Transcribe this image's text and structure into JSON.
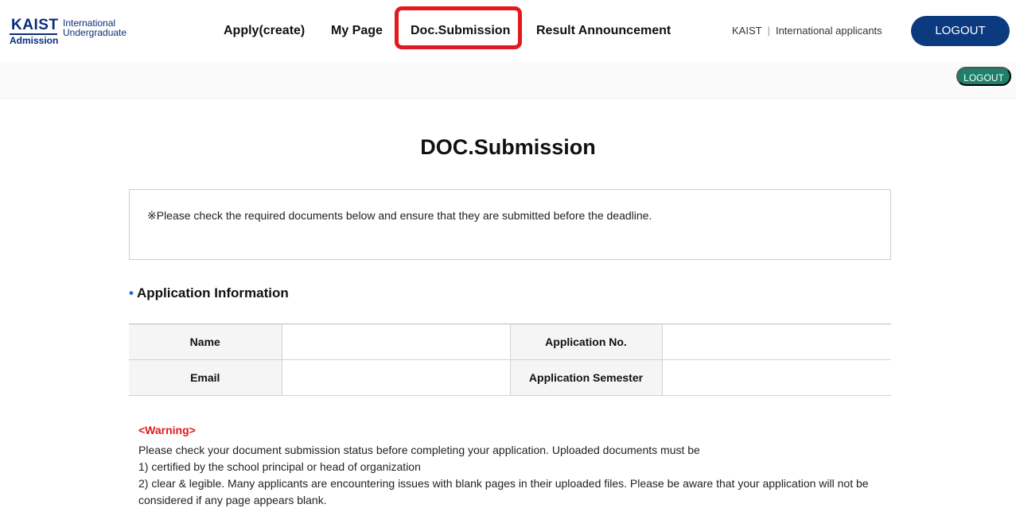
{
  "logo": {
    "kaist": "KAIST",
    "admission": "Admission",
    "international": "International",
    "undergraduate": "Undergraduate"
  },
  "nav": {
    "apply": "Apply(create)",
    "mypage": "My Page",
    "doc_submission": "Doc.Submission",
    "result": "Result Announcement"
  },
  "header": {
    "kaist_link": "KAIST",
    "separator": "|",
    "applicants_link": "International applicants",
    "logout_label": "LOGOUT"
  },
  "subbar": {
    "logout_label": "LOGOUT"
  },
  "page": {
    "title": "DOC.Submission",
    "notice": "※Please check the required documents below and ensure that they are submitted before the deadline."
  },
  "application_info": {
    "section_title": "Application Information",
    "rows": [
      {
        "label1": "Name",
        "value1": "",
        "label2": "Application No.",
        "value2": ""
      },
      {
        "label1": "Email",
        "value1": "",
        "label2": "Application Semester",
        "value2": ""
      }
    ]
  },
  "warning": {
    "title": "<Warning>",
    "line1": "Please check your document submission status before completing your application. Uploaded documents must be",
    "line2": "1) certified by the school principal or head of organization",
    "line3": "2) clear & legible. Many applicants are encountering issues with blank pages in their uploaded files. Please be aware that your application will not be considered if any page appears blank."
  },
  "colors": {
    "brand_navy": "#0b3a7e",
    "logout_green": "#1e7f6a",
    "highlight_red": "#e5181e",
    "warning_red": "#e31b1b"
  }
}
